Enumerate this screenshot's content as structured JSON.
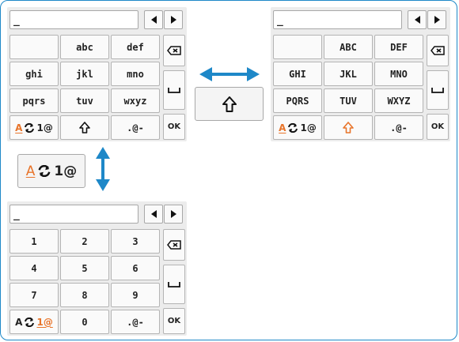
{
  "colors": {
    "border": "#1e88c8",
    "arrow": "#1e88c8",
    "accent": "#e8742a"
  },
  "keyboards": {
    "lower": {
      "input_value": "_",
      "keys": [
        "",
        "abc",
        "def",
        "ghi",
        "jkl",
        "mno",
        "pqrs",
        "tuv",
        "wxyz"
      ],
      "mode_key": {
        "a": "A",
        "n": "1@"
      },
      "bottom_mid_icon": "shift-outline-icon",
      "bottom_right": ".@-",
      "ok": "OK"
    },
    "upper": {
      "input_value": "_",
      "keys": [
        "",
        "ABC",
        "DEF",
        "GHI",
        "JKL",
        "MNO",
        "PQRS",
        "TUV",
        "WXYZ"
      ],
      "mode_key": {
        "a": "A",
        "n": "1@"
      },
      "bottom_mid_icon": "shift-orange-icon",
      "bottom_right": ".@-",
      "ok": "OK"
    },
    "numeric": {
      "input_value": "_",
      "keys": [
        "1",
        "2",
        "3",
        "4",
        "5",
        "6",
        "7",
        "8",
        "9"
      ],
      "mode_key": {
        "a": "A",
        "n": "1@"
      },
      "bottom_mid": "0",
      "bottom_right": ".@-",
      "ok": "OK"
    }
  },
  "callouts": {
    "shift_button_icon": "shift-icon",
    "mode_button": {
      "a": "A",
      "n": "1@"
    }
  }
}
